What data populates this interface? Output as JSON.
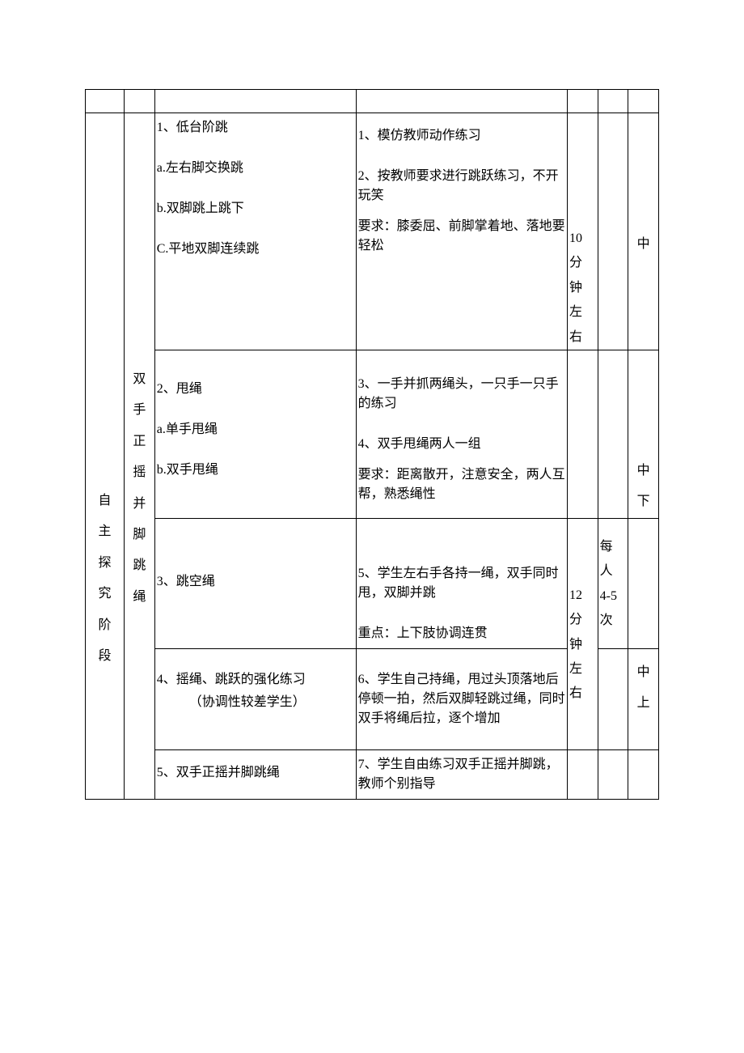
{
  "phase": "自主探究阶段",
  "topic": "双手正摇并脚跳绳",
  "sections": [
    {
      "left": {
        "title": "1、低台阶跳",
        "items": [
          "a.左右脚交换跳",
          "b.双脚跳上跳下",
          "C.平地双脚连续跳"
        ]
      },
      "right": {
        "lines": [
          "1、模仿教师动作练习",
          "2、按教师要求进行跳跃练习，不开玩笑"
        ],
        "req_label": "要求：",
        "req_lines": [
          "膝委屈、前脚掌着地、落地要轻松"
        ]
      },
      "time": "10分钟左右",
      "reps": "",
      "intensity": "中"
    },
    {
      "left": {
        "title": "2、甩绳",
        "items": [
          "a.单手甩绳",
          "b.双手甩绳"
        ]
      },
      "right": {
        "lines": [
          "3、一手并抓两绳头，一只手一只手的练习",
          "4、双手甩绳两人一组"
        ],
        "req_label": "要求：",
        "req_lines": [
          "距离散开，注意安全，两人互帮，熟悉绳性"
        ]
      },
      "time": "",
      "reps": "",
      "intensity": "中下"
    },
    {
      "left": {
        "title": "3、跳空绳",
        "items": []
      },
      "right": {
        "lines": [
          "5、学生左右手各持一绳，双手同时甩，双脚并跳"
        ],
        "req_label": "重点：",
        "req_lines": [
          "上下肢协调连贯"
        ]
      },
      "time": "12分钟左右",
      "reps": "每人4-5次",
      "intensity": ""
    },
    {
      "left": {
        "title": "4、摇绳、跳跃的强化练习",
        "note": "（协调性较差学生）"
      },
      "right": {
        "lines": [
          "6、学生自己持绳，甩过头顶落地后停顿一拍，然后双脚轻跳过绳，同时双手将绳后拉，逐个增加"
        ]
      },
      "time": "",
      "reps": "",
      "intensity": "中上"
    },
    {
      "left": {
        "title": "5、双手正摇并脚跳绳"
      },
      "right": {
        "lines": [
          "7、学生自由练习双手正摇并脚跳，教师个别指导"
        ]
      },
      "time": "",
      "reps": "",
      "intensity": ""
    }
  ]
}
